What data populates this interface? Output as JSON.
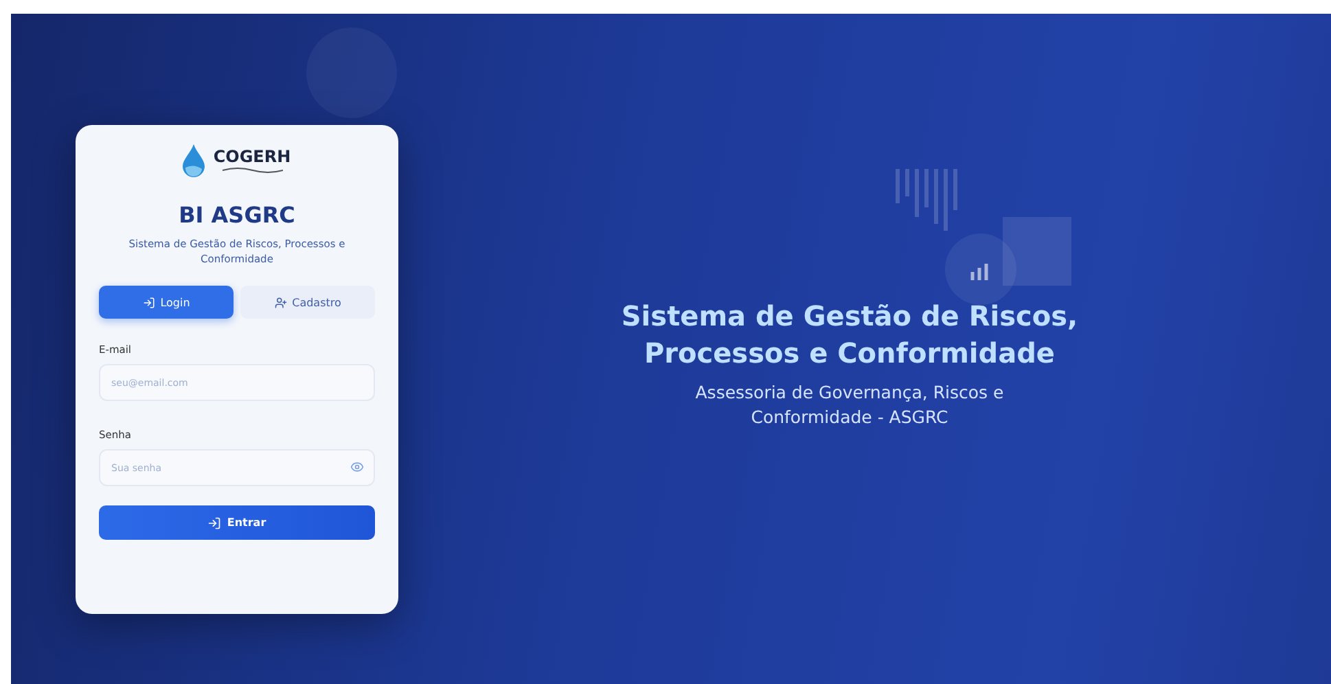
{
  "brand": {
    "name": "COGERH"
  },
  "app_title": "BI ASGRC",
  "app_subtitle": "Sistema de Gestão de Riscos, Processos e Conformidade",
  "tabs": [
    {
      "label": "Login",
      "kind": "login",
      "selected": true
    },
    {
      "label": "Cadastro",
      "kind": "signup",
      "selected": false
    }
  ],
  "fields": [
    {
      "label": "E-mail",
      "placeholder": "seu@email.com",
      "kind": "email"
    },
    {
      "label": "Senha",
      "placeholder": "Sua senha",
      "kind": "password"
    }
  ],
  "submit": {
    "label": "Entrar"
  },
  "hero": {
    "title": "Sistema de Gestão de Riscos, Processos e Conformidade",
    "subtitle": "Assessoria de Governança, Riscos e Conformidade - ASGRC"
  }
}
